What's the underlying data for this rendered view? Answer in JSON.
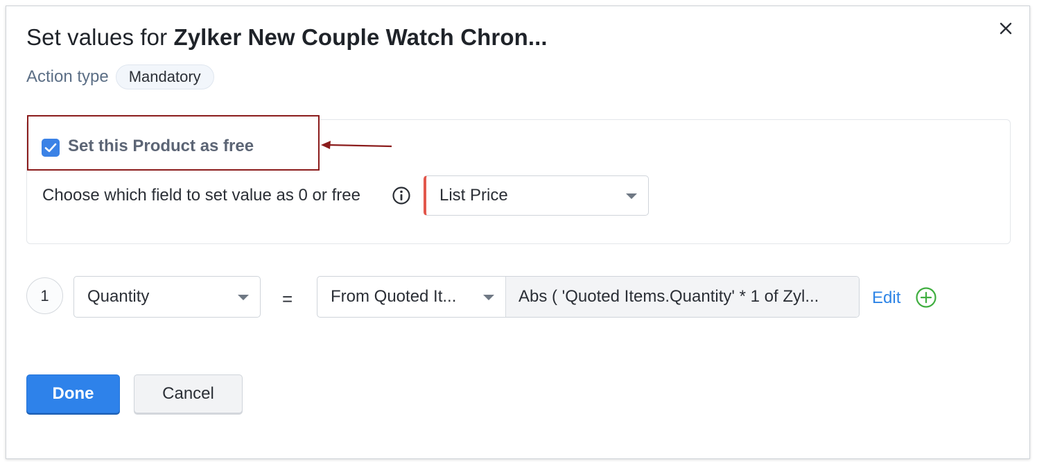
{
  "dialog": {
    "title_prefix": "Set values for",
    "title_product": "Zylker New Couple Watch Chron...",
    "close_icon": "close-icon"
  },
  "action": {
    "label": "Action type",
    "value": "Mandatory"
  },
  "free_section": {
    "checkbox_checked": true,
    "checkbox_label": "Set this Product as free",
    "choose_label": "Choose which field to set value as 0 or free",
    "field_select_value": "List Price"
  },
  "rule": {
    "index": "1",
    "field": "Quantity",
    "operator": "=",
    "source": "From Quoted It...",
    "formula": "Abs ( 'Quoted Items.Quantity' * 1 of Zyl...",
    "edit_label": "Edit"
  },
  "buttons": {
    "done": "Done",
    "cancel": "Cancel"
  },
  "colors": {
    "accent": "#2e82ea",
    "highlight": "#8b1c1c",
    "add": "#3fae3f",
    "required": "#e2574c"
  }
}
